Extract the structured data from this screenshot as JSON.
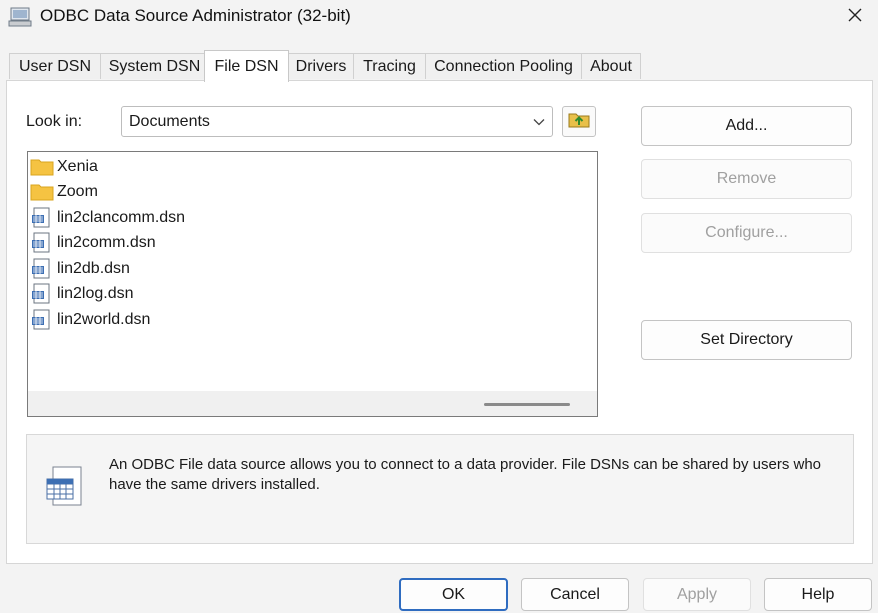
{
  "window": {
    "title": "ODBC Data Source Administrator (32-bit)",
    "icon": "odbc-app-icon",
    "close_icon": "close-icon"
  },
  "tabs": [
    {
      "label": "User DSN",
      "active": false
    },
    {
      "label": "System DSN",
      "active": false
    },
    {
      "label": "File DSN",
      "active": true
    },
    {
      "label": "Drivers",
      "active": false
    },
    {
      "label": "Tracing",
      "active": false
    },
    {
      "label": "Connection Pooling",
      "active": false
    },
    {
      "label": "About",
      "active": false
    }
  ],
  "look_in": {
    "label": "Look in:",
    "value": "Documents",
    "up_folder_icon": "folder-up-icon"
  },
  "files": [
    {
      "name": "Xenia",
      "icon": "folder-icon"
    },
    {
      "name": "Zoom",
      "icon": "folder-icon"
    },
    {
      "name": "lin2clancomm.dsn",
      "icon": "dsn-file-icon"
    },
    {
      "name": "lin2comm.dsn",
      "icon": "dsn-file-icon"
    },
    {
      "name": "lin2db.dsn",
      "icon": "dsn-file-icon"
    },
    {
      "name": "lin2log.dsn",
      "icon": "dsn-file-icon"
    },
    {
      "name": "lin2world.dsn",
      "icon": "dsn-file-icon"
    }
  ],
  "side_buttons": {
    "add": {
      "label": "Add...",
      "enabled": true
    },
    "remove": {
      "label": "Remove",
      "enabled": false
    },
    "configure": {
      "label": "Configure...",
      "enabled": false
    },
    "set_directory": {
      "label": "Set Directory",
      "enabled": true
    }
  },
  "info": {
    "text": "An ODBC File data source allows you to connect to a data provider.  File DSNs can be shared by users who have the same drivers installed.",
    "icon": "dsn-info-icon"
  },
  "footer_buttons": {
    "ok": {
      "label": "OK",
      "enabled": true
    },
    "cancel": {
      "label": "Cancel",
      "enabled": true
    },
    "apply": {
      "label": "Apply",
      "enabled": false
    },
    "help": {
      "label": "Help",
      "enabled": true
    }
  },
  "colors": {
    "accent": "#2f6cc0",
    "folder": "#f5c342",
    "disabled_text": "#a0a0a0"
  }
}
